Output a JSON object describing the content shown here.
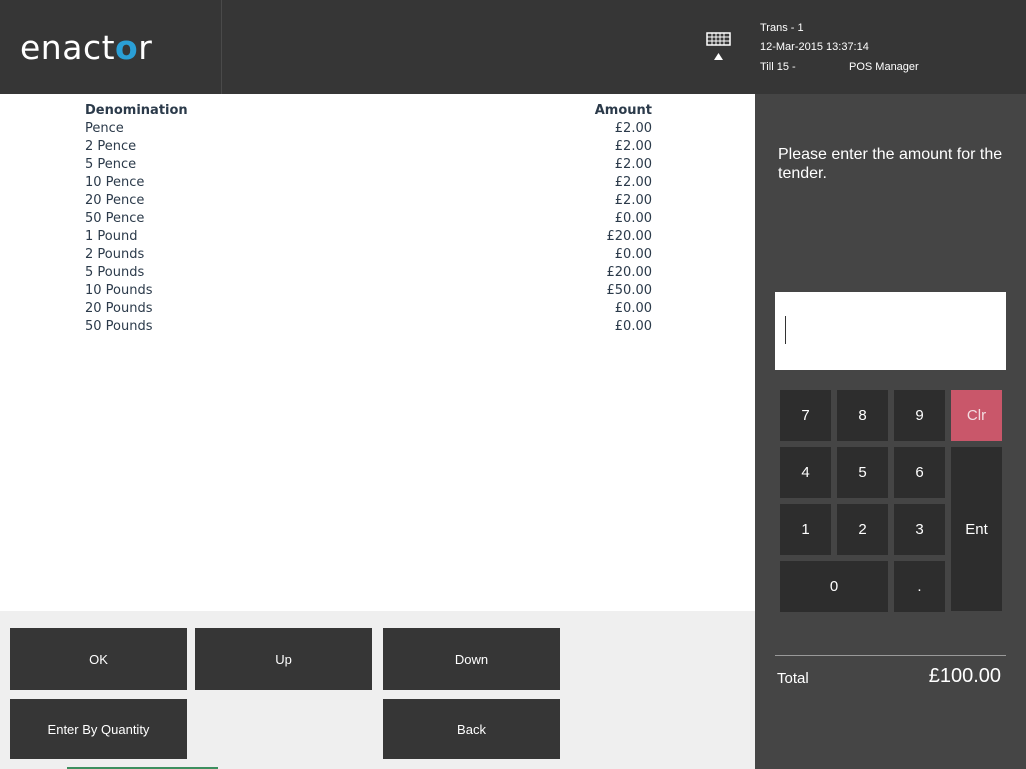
{
  "header": {
    "logo_text": "enactor",
    "keyboard_icon": "keyboard-icon",
    "trans": "Trans - 1",
    "datetime": "12-Mar-2015 13:37:14",
    "till": "Till 15 -",
    "user": "POS Manager"
  },
  "table": {
    "headers": {
      "denomination": "Denomination",
      "amount": "Amount"
    },
    "rows": [
      {
        "name": "Pence",
        "amount": "£2.00"
      },
      {
        "name": "2 Pence",
        "amount": "£2.00"
      },
      {
        "name": "5 Pence",
        "amount": "£2.00"
      },
      {
        "name": "10 Pence",
        "amount": "£2.00"
      },
      {
        "name": "20 Pence",
        "amount": "£2.00"
      },
      {
        "name": "50 Pence",
        "amount": "£0.00"
      },
      {
        "name": "1 Pound",
        "amount": "£20.00"
      },
      {
        "name": "2 Pounds",
        "amount": "£0.00"
      },
      {
        "name": "5 Pounds",
        "amount": "£20.00"
      },
      {
        "name": "10 Pounds",
        "amount": "£50.00"
      },
      {
        "name": "20 Pounds",
        "amount": "£0.00"
      },
      {
        "name": "50 Pounds",
        "amount": "£0.00"
      }
    ]
  },
  "buttons": {
    "ok": "OK",
    "up": "Up",
    "down": "Down",
    "enter_by_quantity": "Enter By Quantity",
    "back": "Back"
  },
  "prompt": "Please enter the amount for the tender.",
  "amount_input": {
    "value": ""
  },
  "keypad": {
    "k7": "7",
    "k8": "8",
    "k9": "9",
    "clr": "Clr",
    "k4": "4",
    "k5": "5",
    "k6": "6",
    "k1": "1",
    "k2": "2",
    "k3": "3",
    "ent": "Ent",
    "k0": "0",
    "dot": "."
  },
  "total": {
    "label": "Total",
    "value": "£100.00"
  },
  "colors": {
    "header_bg": "#363636",
    "panel_bg": "#454545",
    "key_bg": "#2d2d2d",
    "clear_key": "#c9576a",
    "logo_accent": "#2a9fd6"
  }
}
